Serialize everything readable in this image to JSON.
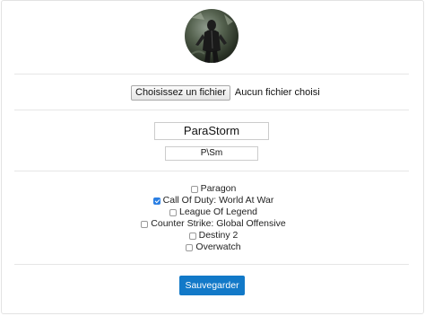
{
  "profile": {
    "file_button_label": "Choisissez un fichier",
    "file_status": "Aucun fichier choisi",
    "username": "ParaStorm",
    "tag": "P\\Sm"
  },
  "games": [
    {
      "label": "Paragon",
      "checked": false
    },
    {
      "label": "Call Of Duty: World At War",
      "checked": true
    },
    {
      "label": "League Of Legend",
      "checked": false
    },
    {
      "label": "Counter Strike: Global Offensive",
      "checked": false
    },
    {
      "label": "Destiny 2",
      "checked": false
    },
    {
      "label": "Overwatch",
      "checked": false
    }
  ],
  "actions": {
    "save_label": "Sauvegarder"
  },
  "colors": {
    "accent": "#1279c8",
    "checkbox_checked": "#2b7fe3"
  }
}
